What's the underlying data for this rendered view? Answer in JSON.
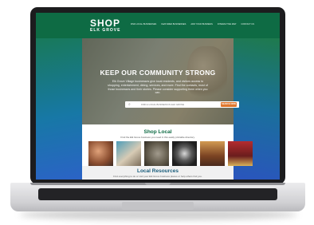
{
  "brand": {
    "logo_main": "SHOP",
    "logo_sub": "ELK GROVE",
    "color_primary": "#0e6b44",
    "color_accent": "#e0772d"
  },
  "nav": {
    "items": [
      "FIND LOCAL BUSINESSES",
      "FEATURED BUSINESSES",
      "ADD YOUR BUSINESS",
      "INTERACTIVE MAP",
      "CONTACT US"
    ]
  },
  "hero": {
    "title": "KEEP OUR COMMUNITY STRONG",
    "body": "Elk Grove Village businesses give local residents, and visitors access to shopping, entertainment, dining, services, and more. Find the contacts, most of those businesses and their stories. Please consider supporting them when you can."
  },
  "search": {
    "placeholder": "FIND A LOCAL BUSINESS IN ELK GROVE",
    "button_label": "SEARCH NOW",
    "icon": "search-icon"
  },
  "shop_local": {
    "title": "Shop Local",
    "subtitle": "Find the Elk Grove business you need in this easily printable directory."
  },
  "resources": {
    "title": "Local Resources",
    "subtitle": "Find everything to do or visit your Elk Grove business places or help others find you."
  }
}
